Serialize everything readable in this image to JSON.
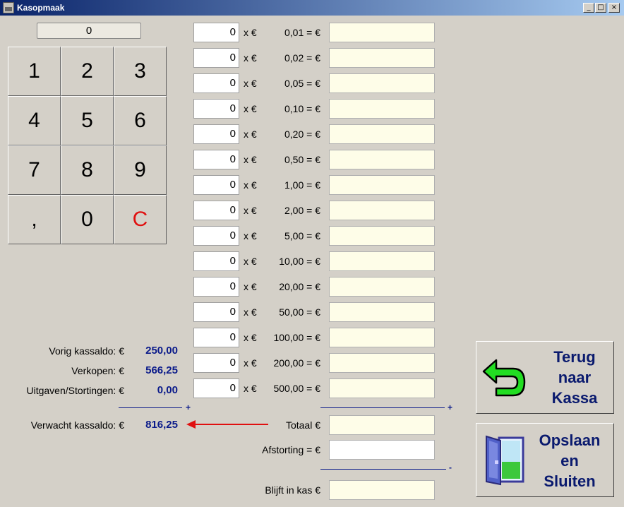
{
  "window": {
    "title": "Kasopmaak"
  },
  "titlebar_buttons": {
    "minimize": "_",
    "maximize": "□",
    "close": "×"
  },
  "keypad": {
    "display": "0",
    "keys": [
      "1",
      "2",
      "3",
      "4",
      "5",
      "6",
      "7",
      "8",
      "9",
      ",",
      "0",
      "C"
    ]
  },
  "denominations": [
    {
      "qty": "0",
      "x": "x  €",
      "value": "0,01 = €"
    },
    {
      "qty": "0",
      "x": "x  €",
      "value": "0,02 = €"
    },
    {
      "qty": "0",
      "x": "x  €",
      "value": "0,05 = €"
    },
    {
      "qty": "0",
      "x": "x  €",
      "value": "0,10 = €"
    },
    {
      "qty": "0",
      "x": "x  €",
      "value": "0,20 = €"
    },
    {
      "qty": "0",
      "x": "x  €",
      "value": "0,50 = €"
    },
    {
      "qty": "0",
      "x": "x  €",
      "value": "1,00 = €"
    },
    {
      "qty": "0",
      "x": "x  €",
      "value": "2,00 = €"
    },
    {
      "qty": "0",
      "x": "x  €",
      "value": "5,00 = €"
    },
    {
      "qty": "0",
      "x": "x  €",
      "value": "10,00 = €"
    },
    {
      "qty": "0",
      "x": "x  €",
      "value": "20,00 = €"
    },
    {
      "qty": "0",
      "x": "x  €",
      "value": "50,00 = €"
    },
    {
      "qty": "0",
      "x": "x  €",
      "value": "100,00 = €"
    },
    {
      "qty": "0",
      "x": "x  €",
      "value": "200,00 = €"
    },
    {
      "qty": "0",
      "x": "x  €",
      "value": "500,00 = €"
    }
  ],
  "summary": {
    "vorig_label": "Vorig kassaldo:  €",
    "vorig_value": "250,00",
    "verkopen_label": "Verkopen:  €",
    "verkopen_value": "566,25",
    "uitgaven_label": "Uitgaven/Stortingen:  €",
    "uitgaven_value": "0,00",
    "plus": "+",
    "verwacht_label": "Verwacht kassaldo:  €",
    "verwacht_value": "816,25",
    "totaal_label": "Totaal  €",
    "afstorting_label": "Afstorting = €",
    "minus": "-",
    "blijft_label": "Blijft in kas €"
  },
  "buttons": {
    "terug": [
      "Terug",
      "naar",
      "Kassa"
    ],
    "opslaan": [
      "Opslaan",
      "en",
      "Sluiten"
    ]
  },
  "colors": {
    "accent_text": "#0a1a8a",
    "clear_key": "#e01010",
    "arrow": "#e01010",
    "amount_bg": "#fefde8"
  }
}
